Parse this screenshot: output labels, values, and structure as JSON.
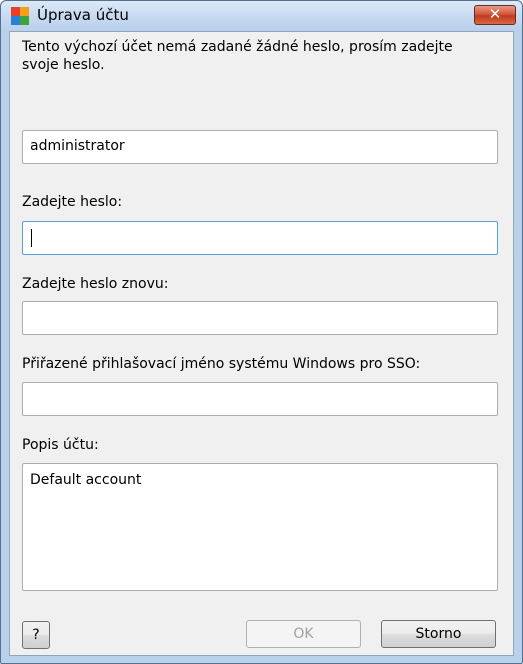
{
  "window": {
    "title": "Úprava účtu",
    "close_glyph": "✕",
    "icon": "avg-logo-icon"
  },
  "intro_text": "Tento výchozí účet nemá zadané žádné heslo, prosím zadejte svoje heslo.",
  "fields": {
    "account_name": {
      "value": "administrator"
    },
    "password": {
      "label": "Zadejte heslo:",
      "value": ""
    },
    "password_confirm": {
      "label": "Zadejte heslo znovu:",
      "value": ""
    },
    "windows_login": {
      "label": "Přiřazené přihlašovací jméno systému Windows pro SSO:",
      "value": ""
    },
    "description": {
      "label": "Popis účtu:",
      "value": "Default account"
    }
  },
  "buttons": {
    "help": "?",
    "ok": "OK",
    "cancel": "Storno"
  },
  "colors": {
    "titlebar": "#c7dbf1",
    "close_button": "#c23a1e",
    "focus_border": "#569de5",
    "client_bg": "#f0f0f0"
  }
}
